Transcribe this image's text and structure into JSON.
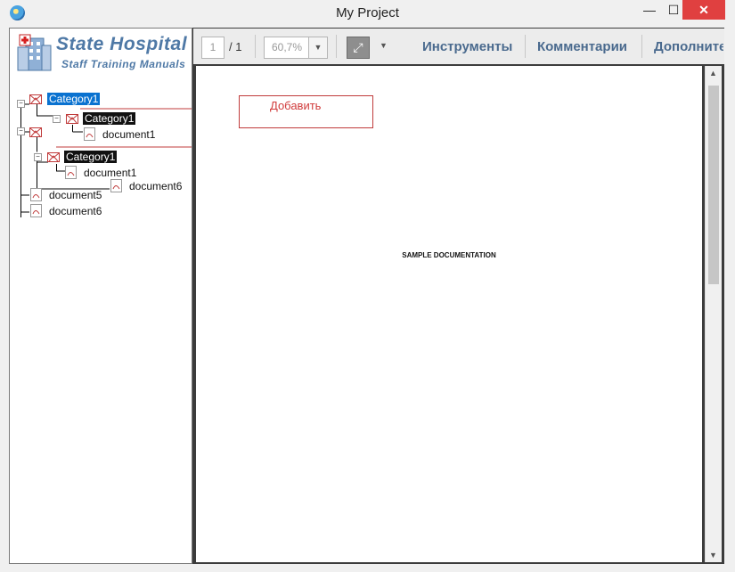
{
  "window": {
    "title": "My Project",
    "minimize": "—",
    "maximize": "☐",
    "close": "✕"
  },
  "logo": {
    "title": "State Hospital",
    "subtitle": "Staff Training Manuals"
  },
  "tree": {
    "n1": "Category1",
    "n2": "Category1",
    "n3": "document1",
    "n4": "Category1",
    "n5": "document1",
    "n6": "document6",
    "n7": "document5",
    "n8": "document6"
  },
  "popup": {
    "label": "Добавить"
  },
  "toolbar": {
    "page_current": "1",
    "page_total": "/ 1",
    "zoom": "60,7%",
    "tools": "Инструменты",
    "comments": "Комментарии",
    "more": "Дополните"
  },
  "document": {
    "text": "SAMPLE DOCUMENTATION"
  }
}
